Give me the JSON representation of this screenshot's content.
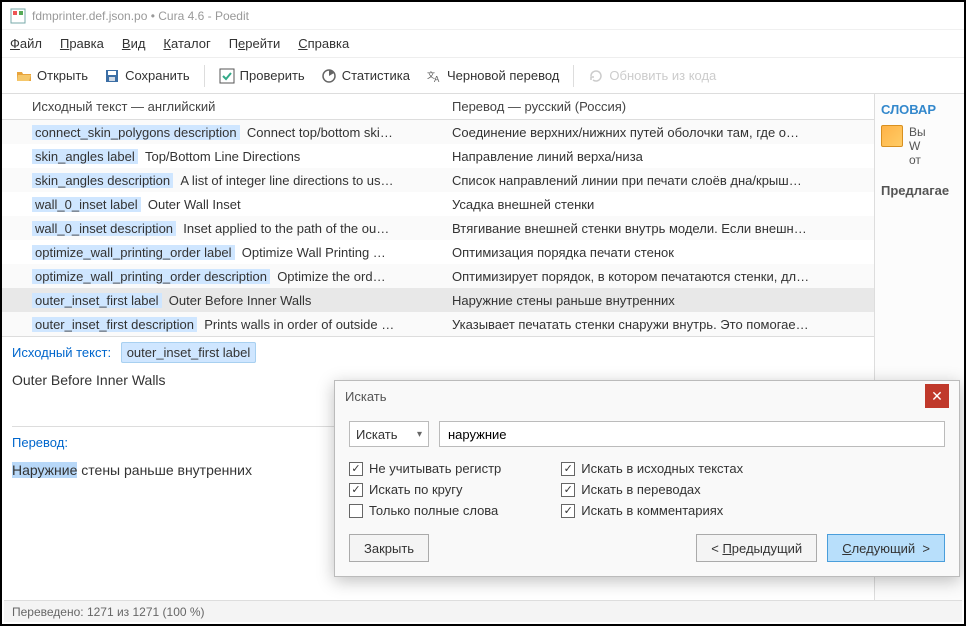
{
  "title": "fdmprinter.def.json.po • Cura 4.6 - Poedit",
  "menu": {
    "file": "Файл",
    "edit": "Правка",
    "view": "Вид",
    "catalog": "Каталог",
    "go": "Перейти",
    "help": "Справка"
  },
  "toolbar": {
    "open": "Открыть",
    "save": "Сохранить",
    "check": "Проверить",
    "stats": "Статистика",
    "pretrans": "Черновой перевод",
    "update": "Обновить из кода"
  },
  "headers": {
    "source": "Исходный текст — английский",
    "translation": "Перевод — русский (Россия)"
  },
  "rows": [
    {
      "key": "connect_skin_polygons description",
      "src": "Connect top/bottom ski…",
      "tr": "Соединение верхних/нижних путей оболочки там, где о…"
    },
    {
      "key": "skin_angles label",
      "src": "Top/Bottom Line Directions",
      "tr": "Направление линий верха/низа"
    },
    {
      "key": "skin_angles description",
      "src": "A list of integer line directions to us…",
      "tr": "Список направлений линии при печати слоёв дна/крыш…"
    },
    {
      "key": "wall_0_inset label",
      "src": "Outer Wall Inset",
      "tr": "Усадка внешней стенки"
    },
    {
      "key": "wall_0_inset description",
      "src": "Inset applied to the path of the ou…",
      "tr": "Втягивание внешней стенки внутрь модели. Если внешн…"
    },
    {
      "key": "optimize_wall_printing_order label",
      "src": "Optimize Wall Printing …",
      "tr": "Оптимизация порядка печати стенок"
    },
    {
      "key": "optimize_wall_printing_order description",
      "src": "Optimize the ord…",
      "tr": "Оптимизирует порядок, в котором печатаются стенки, дл…"
    },
    {
      "key": "outer_inset_first label",
      "src": "Outer Before Inner Walls",
      "tr": "Наружние стены раньше внутренних",
      "selected": true
    },
    {
      "key": "outer_inset_first description",
      "src": "Prints walls in order of outside …",
      "tr": "Указывает печатать стенки снаружи внутрь. Это помогае…"
    }
  ],
  "detail": {
    "source_label": "Исходный текст:",
    "source_key": "outer_inset_first label",
    "source_text": "Outer Before Inner Walls",
    "translation_label": "Перевод:",
    "translation_hl": "Наружние",
    "translation_rest": " стены раньше внутренних"
  },
  "right": {
    "dict": "СЛОВАР",
    "w1": "Вы",
    "w2": "W",
    "w3": "от",
    "suggest": "Предлагае"
  },
  "status": "Переведено: 1271 из 1271 (100 %)",
  "find": {
    "title": "Искать",
    "mode": "Искать",
    "text": "наружние",
    "ignore_case": "Не учитывать регистр",
    "wrap": "Искать по кругу",
    "whole": "Только полные слова",
    "in_source": "Искать в исходных текстах",
    "in_trans": "Искать в переводах",
    "in_comments": "Искать в комментариях",
    "close": "Закрыть",
    "prev": "< Предыдущий",
    "next": "Следующий  >",
    "checked": {
      "ignore_case": true,
      "wrap": true,
      "whole": false,
      "in_source": true,
      "in_trans": true,
      "in_comments": true
    }
  }
}
